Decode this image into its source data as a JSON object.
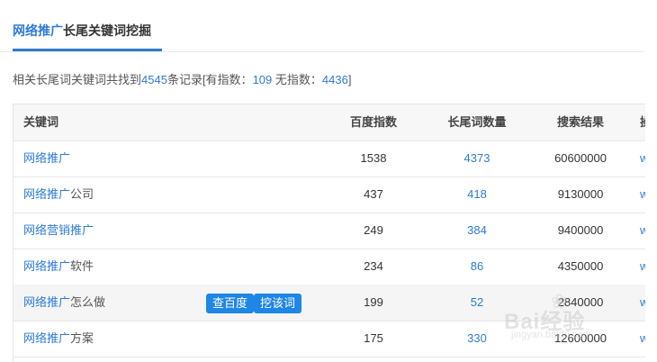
{
  "tab": {
    "highlight": "网络推广",
    "rest": "长尾关键词挖掘"
  },
  "summary": {
    "prefix": "相关长尾词关键词共找到",
    "total": "4545",
    "mid1": "条记录[有指数：",
    "with_index": "109",
    "mid2": " 无指数：",
    "without_index": "4436",
    "suffix": "]"
  },
  "table": {
    "headers": {
      "keyword": "关键词",
      "baidu_index": "百度指数",
      "longtail_count": "长尾词数量",
      "search_results": "搜索结果",
      "more": "操"
    },
    "rows": [
      {
        "kw_hl": "网络推广",
        "kw_rest": "",
        "baidu_index": "1538",
        "longtail_count": "4373",
        "search_results": "60600000",
        "more": "w"
      },
      {
        "kw_hl": "网络推广",
        "kw_rest": "公司",
        "baidu_index": "437",
        "longtail_count": "418",
        "search_results": "9130000",
        "more": "w"
      },
      {
        "kw_hl_pre": "网络营销",
        "kw_hl": "推广",
        "baidu_index": "249",
        "longtail_count": "384",
        "search_results": "9400000",
        "more": "w"
      },
      {
        "kw_hl": "网络推广",
        "kw_rest": "软件",
        "baidu_index": "234",
        "longtail_count": "86",
        "search_results": "4350000",
        "more": "w"
      },
      {
        "kw_hl": "网络推广",
        "kw_rest": "怎么做",
        "baidu_index": "199",
        "longtail_count": "52",
        "search_results": "2840000",
        "more": "w"
      },
      {
        "kw_hl": "网络推广",
        "kw_rest": "方案",
        "baidu_index": "175",
        "longtail_count": "330",
        "search_results": "12600000",
        "more": "w"
      }
    ],
    "row_buttons": {
      "baidu": "查百度",
      "mine": "挖该词"
    }
  },
  "watermark": {
    "brand": "Bai经验",
    "url": "jingyan.baidu.com"
  },
  "colors": {
    "accent": "#2d7bd4",
    "button": "#1e86e6"
  }
}
